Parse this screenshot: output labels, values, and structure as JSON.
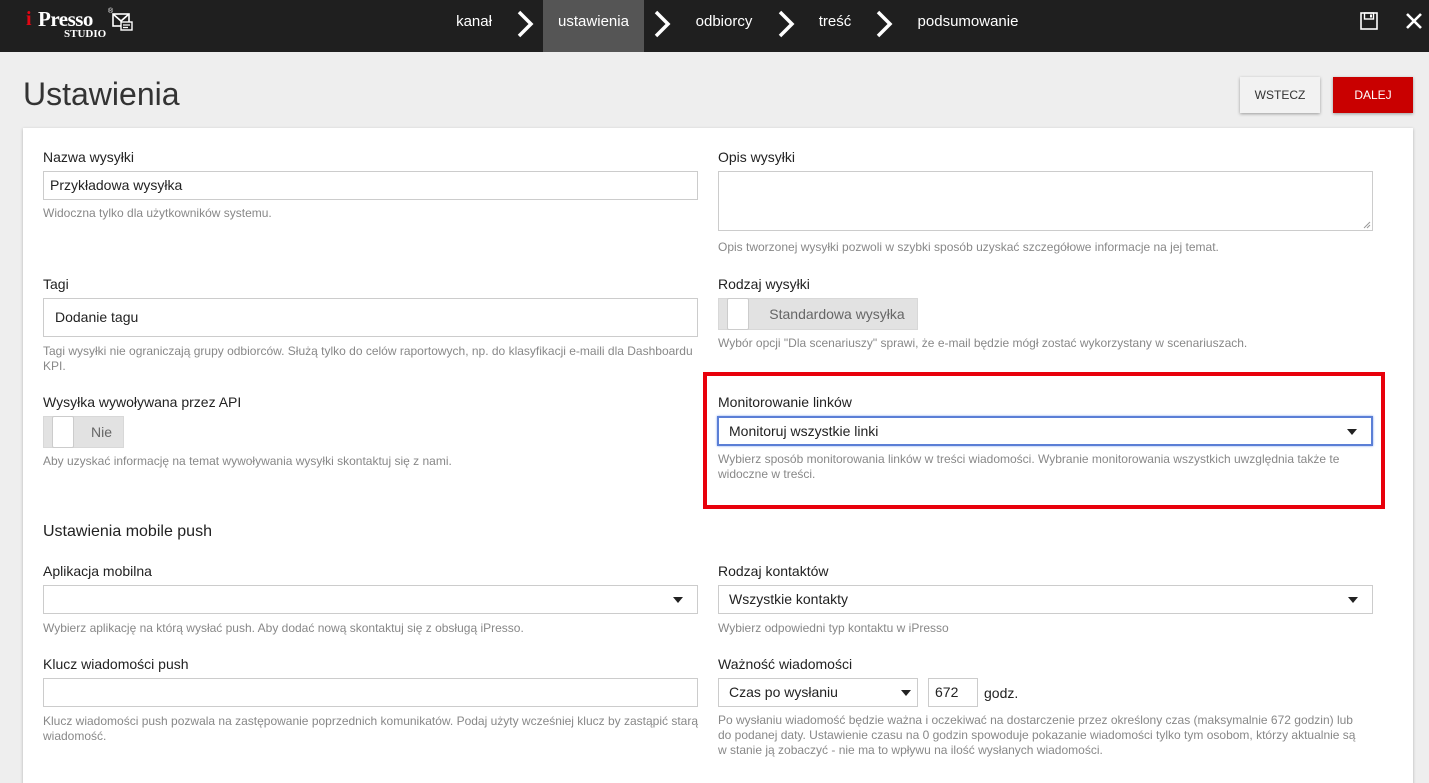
{
  "header": {
    "logo": {
      "i": "i",
      "presso": "Presso",
      "reg": "®",
      "studio": "STUDIO"
    },
    "steps": [
      {
        "label": "kanał",
        "active": false
      },
      {
        "label": "ustawienia",
        "active": true
      },
      {
        "label": "odbiorcy",
        "active": false
      },
      {
        "label": "treść",
        "active": false
      },
      {
        "label": "podsumowanie",
        "active": false
      }
    ],
    "icons": [
      "save-icon",
      "close-icon"
    ]
  },
  "page": {
    "title": "Ustawienia",
    "back_label": "WSTECZ",
    "next_label": "DALEJ"
  },
  "form": {
    "name": {
      "label": "Nazwa wysyłki",
      "value": "Przykładowa wysyłka",
      "help": "Widoczna tylko dla użytkowników systemu."
    },
    "description": {
      "label": "Opis wysyłki",
      "value": "",
      "help": "Opis tworzonej wysyłki pozwoli w szybki sposób uzyskać szczegółowe informacje na jej temat."
    },
    "tags": {
      "label": "Tagi",
      "placeholder": "Dodanie tagu",
      "help": "Tagi wysyłki nie ograniczają grupy odbiorców. Służą tylko do celów raportowych, np. do klasyfikacji e-maili dla Dashboardu KPI."
    },
    "send_type": {
      "label": "Rodzaj wysyłki",
      "toggle_label": "Standardowa wysyłka",
      "help": "Wybór opcji \"Dla scenariuszy\" sprawi, że e-mail będzie mógł zostać wykorzystany w scenariuszach."
    },
    "api": {
      "label": "Wysyłka wywoływana przez API",
      "toggle_label": "Nie",
      "help": "Aby uzyskać informację na temat wywoływania wysyłki skontaktuj się z nami."
    },
    "link_monitoring": {
      "label": "Monitorowanie linków",
      "value": "Monitoruj wszystkie linki",
      "help": "Wybierz sposób monitorowania linków w treści wiadomości. Wybranie monitorowania wszystkich uwzględnia także te widoczne w treści."
    },
    "mobile_push_title": "Ustawienia mobile push",
    "mobile_app": {
      "label": "Aplikacja mobilna",
      "value": "",
      "help": "Wybierz aplikację na którą wysłać push. Aby dodać nową skontaktuj się z obsługą iPresso."
    },
    "contact_type": {
      "label": "Rodzaj kontaktów",
      "value": "Wszystkie kontakty",
      "help": "Wybierz odpowiedni typ kontaktu w iPresso"
    },
    "push_key": {
      "label": "Klucz wiadomości push",
      "value": "",
      "help": "Klucz wiadomości push pozwala na zastępowanie poprzednich komunikatów. Podaj użyty wcześniej klucz by zastąpić starą wiadomość."
    },
    "validity": {
      "label": "Ważność wiadomości",
      "mode": "Czas po wysłaniu",
      "hours": "672",
      "unit": "godz.",
      "help": "Po wysłaniu wiadomość będzie ważna i oczekiwać na dostarczenie przez określony czas (maksymalnie 672 godzin) lub do podanej daty. Ustawienie czasu na 0 godzin spowoduje pokazanie wiadomości tylko tym osobom, którzy aktualnie są w stanie ją zobaczyć - nie ma to wpływu na ilość wysłanych wiadomości."
    }
  }
}
